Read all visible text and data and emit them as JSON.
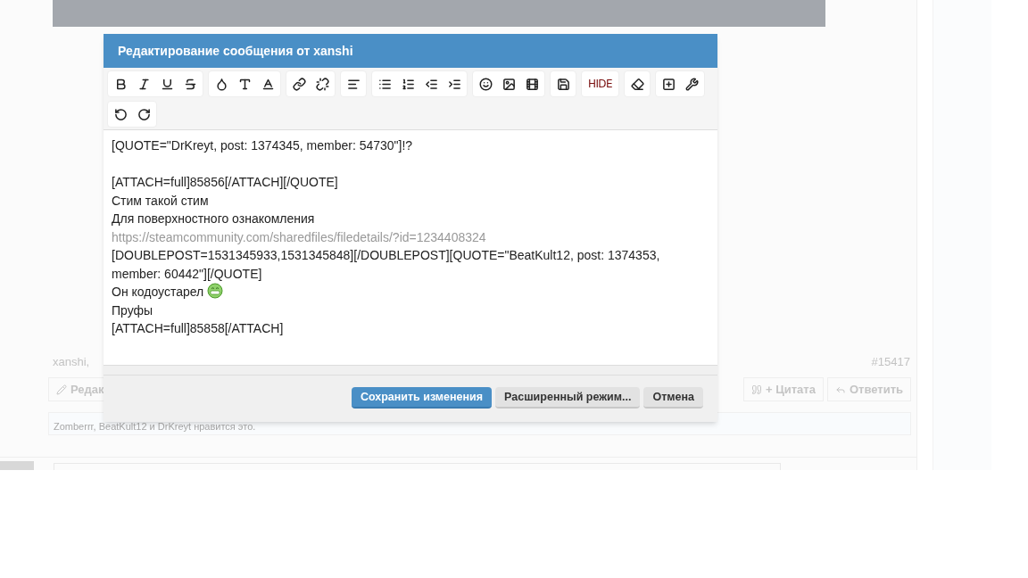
{
  "background": {
    "post_meta": "xanshi,",
    "post_number": "#15417",
    "edit_button": "Редак",
    "quote_button": "+ Цитата",
    "reply_button": "Ответить",
    "likes": "Zomberrr, BeatKult12 и DrKreyt нравится это."
  },
  "dialog": {
    "title": "Редактирование сообщения от xanshi",
    "toolbar": {
      "hide_label": "HIDE"
    },
    "lines": [
      {
        "kind": "text",
        "text": "[QUOTE=\"DrKreyt, post: 1374345, member: 54730\"]!?"
      },
      {
        "kind": "blank"
      },
      {
        "kind": "text",
        "text": "[ATTACH=full]85856[/ATTACH][/QUOTE]"
      },
      {
        "kind": "text",
        "text": "Стим такой стим"
      },
      {
        "kind": "text",
        "text": "Для поверхностного ознакомления"
      },
      {
        "kind": "link",
        "text": "https://steamcommunity.com/sharedfiles/filedetails/?id=1234408324"
      },
      {
        "kind": "text",
        "text": "[DOUBLEPOST=1531345933,1531345848][/DOUBLEPOST][QUOTE=\"BeatKult12, post: 1374353, member: 60442\"][/QUOTE]"
      },
      {
        "kind": "emoji",
        "text": "Он кодоустарел"
      },
      {
        "kind": "text",
        "text": "Пруфы"
      },
      {
        "kind": "text",
        "text": "[ATTACH=full]85858[/ATTACH]"
      }
    ],
    "buttons": [
      {
        "label": "Сохранить изменения",
        "primary": true
      },
      {
        "label": "Расширенный режим...",
        "primary": false
      },
      {
        "label": "Отмена",
        "primary": false
      }
    ]
  }
}
